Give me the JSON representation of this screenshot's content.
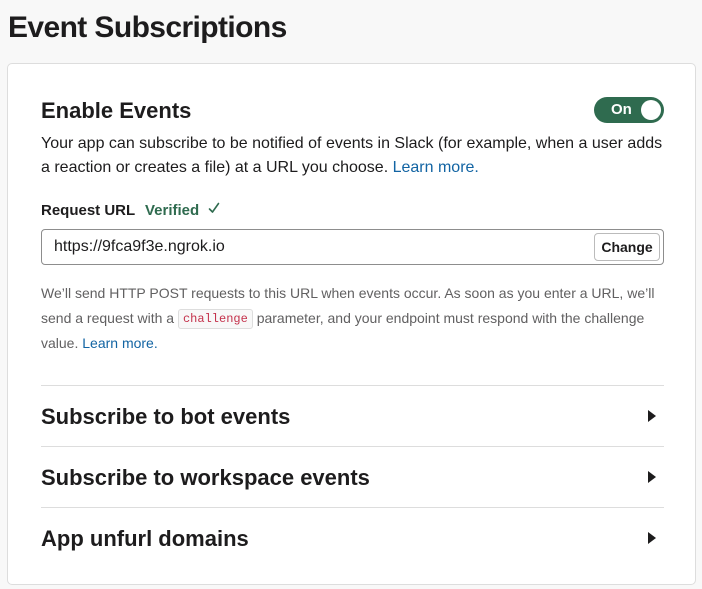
{
  "page": {
    "title": "Event Subscriptions"
  },
  "enable_events": {
    "title": "Enable Events",
    "toggle_label": "On",
    "toggle_state": true,
    "description": "Your app can subscribe to be notified of events in Slack (for example, when a user adds a reaction or creates a file) at a URL you choose.",
    "learn_more": "Learn more."
  },
  "request_url": {
    "label": "Request URL",
    "status": "Verified",
    "status_icon": "check-icon",
    "value": "https://9fca9f3e.ngrok.io",
    "change_label": "Change",
    "help_before": "We’ll send HTTP POST requests to this URL when events occur. As soon as you enter a URL, we’ll send a request with a",
    "help_code": "challenge",
    "help_after": "parameter, and your endpoint must respond with the challenge value.",
    "help_learn_more": "Learn more."
  },
  "sections": [
    {
      "label": "Subscribe to bot events",
      "icon": "caret-right-icon"
    },
    {
      "label": "Subscribe to workspace events",
      "icon": "caret-right-icon"
    },
    {
      "label": "App unfurl domains",
      "icon": "caret-right-icon"
    }
  ],
  "colors": {
    "toggle_on": "#2f6b4f",
    "verified": "#2f6b4f",
    "link": "#1264a3",
    "code": "#c4314b"
  }
}
